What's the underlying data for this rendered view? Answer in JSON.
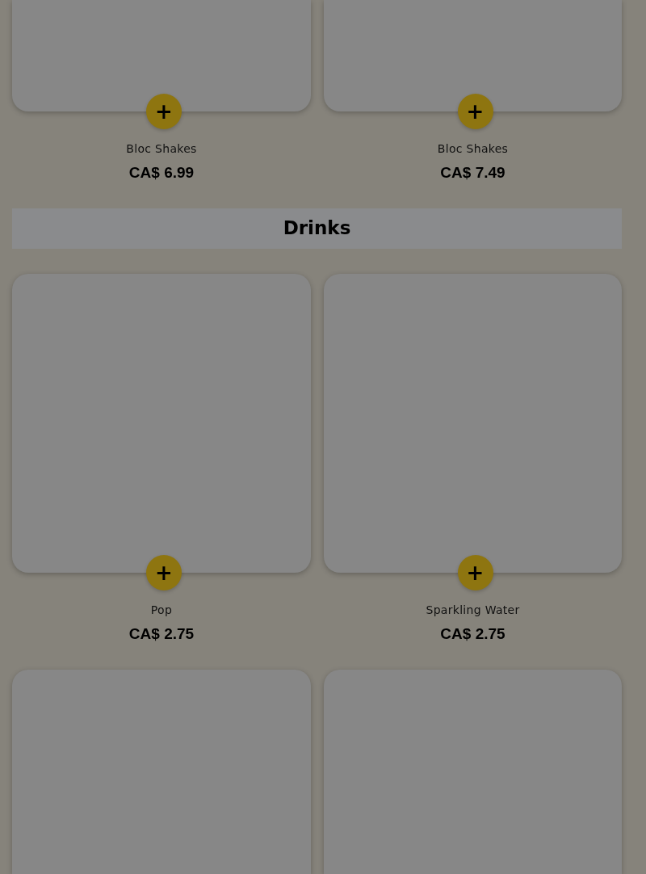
{
  "sections": [
    {
      "items": [
        {
          "kind": "lower_part",
          "name": "Bloc Shakes",
          "price": "CA$ 6.99",
          "add_label": "+"
        },
        {
          "kind": "lower_part",
          "name": "Bloc Shakes",
          "price": "CA$ 7.49",
          "add_label": "+"
        }
      ]
    },
    {
      "title": "Drinks",
      "items": [
        {
          "kind": "full",
          "name": "Pop",
          "price": "CA$ 2.75",
          "add_label": "+"
        },
        {
          "kind": "full",
          "name": "Sparkling Water",
          "price": "CA$ 2.75",
          "add_label": "+"
        },
        {
          "kind": "upper_part"
        },
        {
          "kind": "upper_part"
        }
      ]
    }
  ]
}
